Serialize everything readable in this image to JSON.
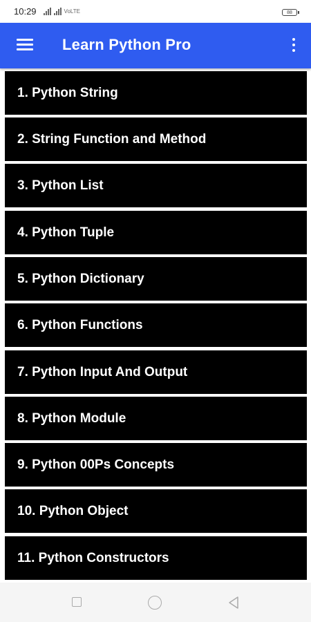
{
  "status_bar": {
    "time": "10:29",
    "network_label": "VoLTE",
    "battery_level": "88"
  },
  "app_bar": {
    "title": "Learn Python Pro",
    "background_color": "#2f5cf0",
    "menu_icon": "hamburger-menu-icon",
    "overflow_icon": "more-vert-icon"
  },
  "topics": [
    {
      "label": "1. Python String"
    },
    {
      "label": "2. String Function and Method"
    },
    {
      "label": "3. Python List"
    },
    {
      "label": "4. Python Tuple"
    },
    {
      "label": "5. Python Dictionary"
    },
    {
      "label": "6. Python Functions"
    },
    {
      "label": "7. Python Input And Output"
    },
    {
      "label": "8. Python Module"
    },
    {
      "label": "9. Python 00Ps Concepts"
    },
    {
      "label": "10. Python Object"
    },
    {
      "label": "11. Python Constructors"
    }
  ],
  "nav_bar": {
    "recents_icon": "square-icon",
    "home_icon": "circle-icon",
    "back_icon": "triangle-back-icon"
  }
}
